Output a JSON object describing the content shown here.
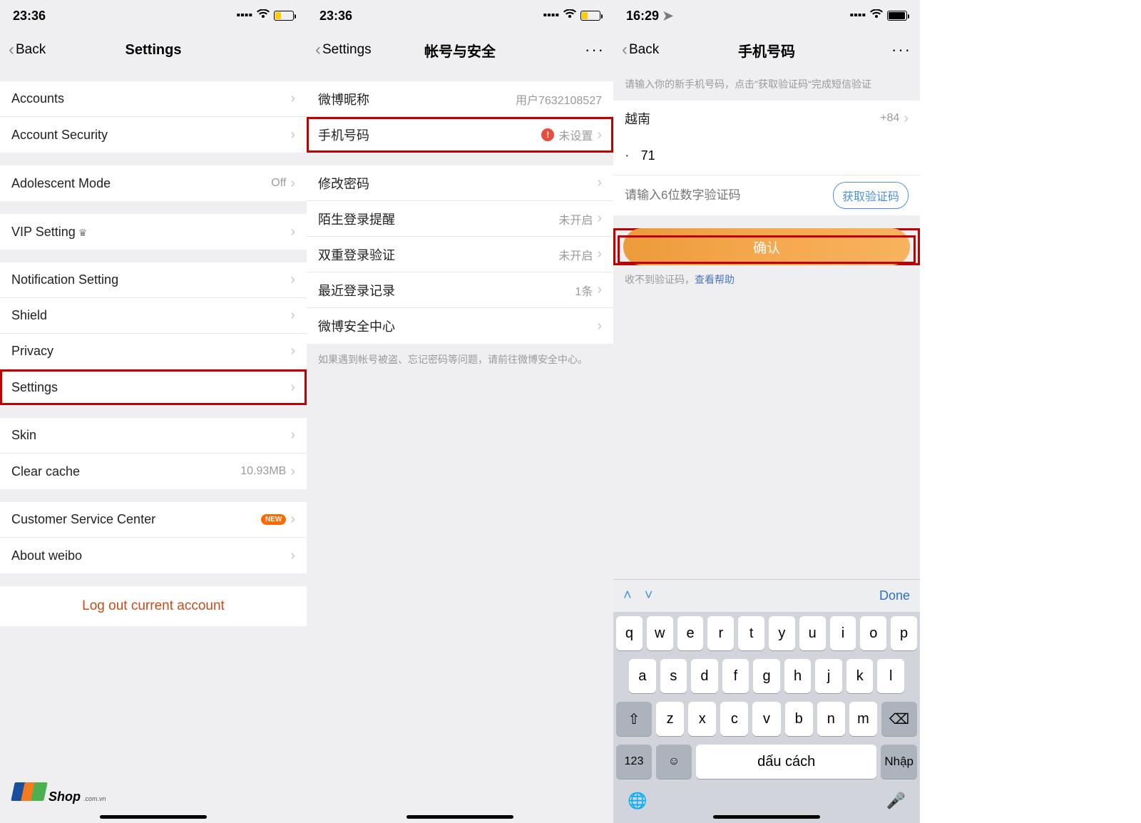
{
  "screen1": {
    "time": "23:36",
    "nav_back": "Back",
    "nav_title": "Settings",
    "rows": {
      "accounts": "Accounts",
      "account_security": "Account Security",
      "adolescent": "Adolescent Mode",
      "adolescent_val": "Off",
      "vip": "VIP Setting",
      "notification": "Notification Setting",
      "shield": "Shield",
      "privacy": "Privacy",
      "settings": "Settings",
      "skin": "Skin",
      "clear_cache": "Clear cache",
      "clear_cache_val": "10.93MB",
      "customer": "Customer Service Center",
      "about": "About weibo",
      "new_badge": "NEW"
    },
    "logout": "Log out current account",
    "logo_text": "Shop",
    "logo_sub": ".com.vn"
  },
  "screen2": {
    "time": "23:36",
    "nav_back": "Settings",
    "nav_title": "帐号与安全",
    "rows": {
      "weibo_nick": "微博昵称",
      "weibo_nick_val": "用户7632108527",
      "phone": "手机号码",
      "phone_val": "未设置",
      "change_pwd": "修改密码",
      "login_alert": "陌生登录提醒",
      "login_alert_val": "未开启",
      "two_factor": "双重登录验证",
      "two_factor_val": "未开启",
      "recent_login": "最近登录记录",
      "recent_login_val": "1条",
      "security_center": "微博安全中心"
    },
    "footer_hint": "如果遇到帐号被盗、忘记密码等问题，请前往微博安全中心。"
  },
  "screen3": {
    "time": "16:29",
    "nav_back": "Back",
    "nav_title": "手机号码",
    "hint": "请输入你的新手机号码，点击\"获取验证码\"完成短信验证",
    "country": "越南",
    "country_code": "+84",
    "phone_value": "71",
    "code_placeholder": "请输入6位数字验证码",
    "code_btn": "获取验证码",
    "confirm": "确认",
    "help_prefix": "收不到验证码，",
    "help_link": "查看帮助",
    "kbd": {
      "done": "Done",
      "row1": [
        "q",
        "w",
        "e",
        "r",
        "t",
        "y",
        "u",
        "i",
        "o",
        "p"
      ],
      "row2": [
        "a",
        "s",
        "d",
        "f",
        "g",
        "h",
        "j",
        "k",
        "l"
      ],
      "row3": [
        "z",
        "x",
        "c",
        "v",
        "b",
        "n",
        "m"
      ],
      "k123": "123",
      "space": "dấu cách",
      "enter": "Nhập"
    }
  }
}
